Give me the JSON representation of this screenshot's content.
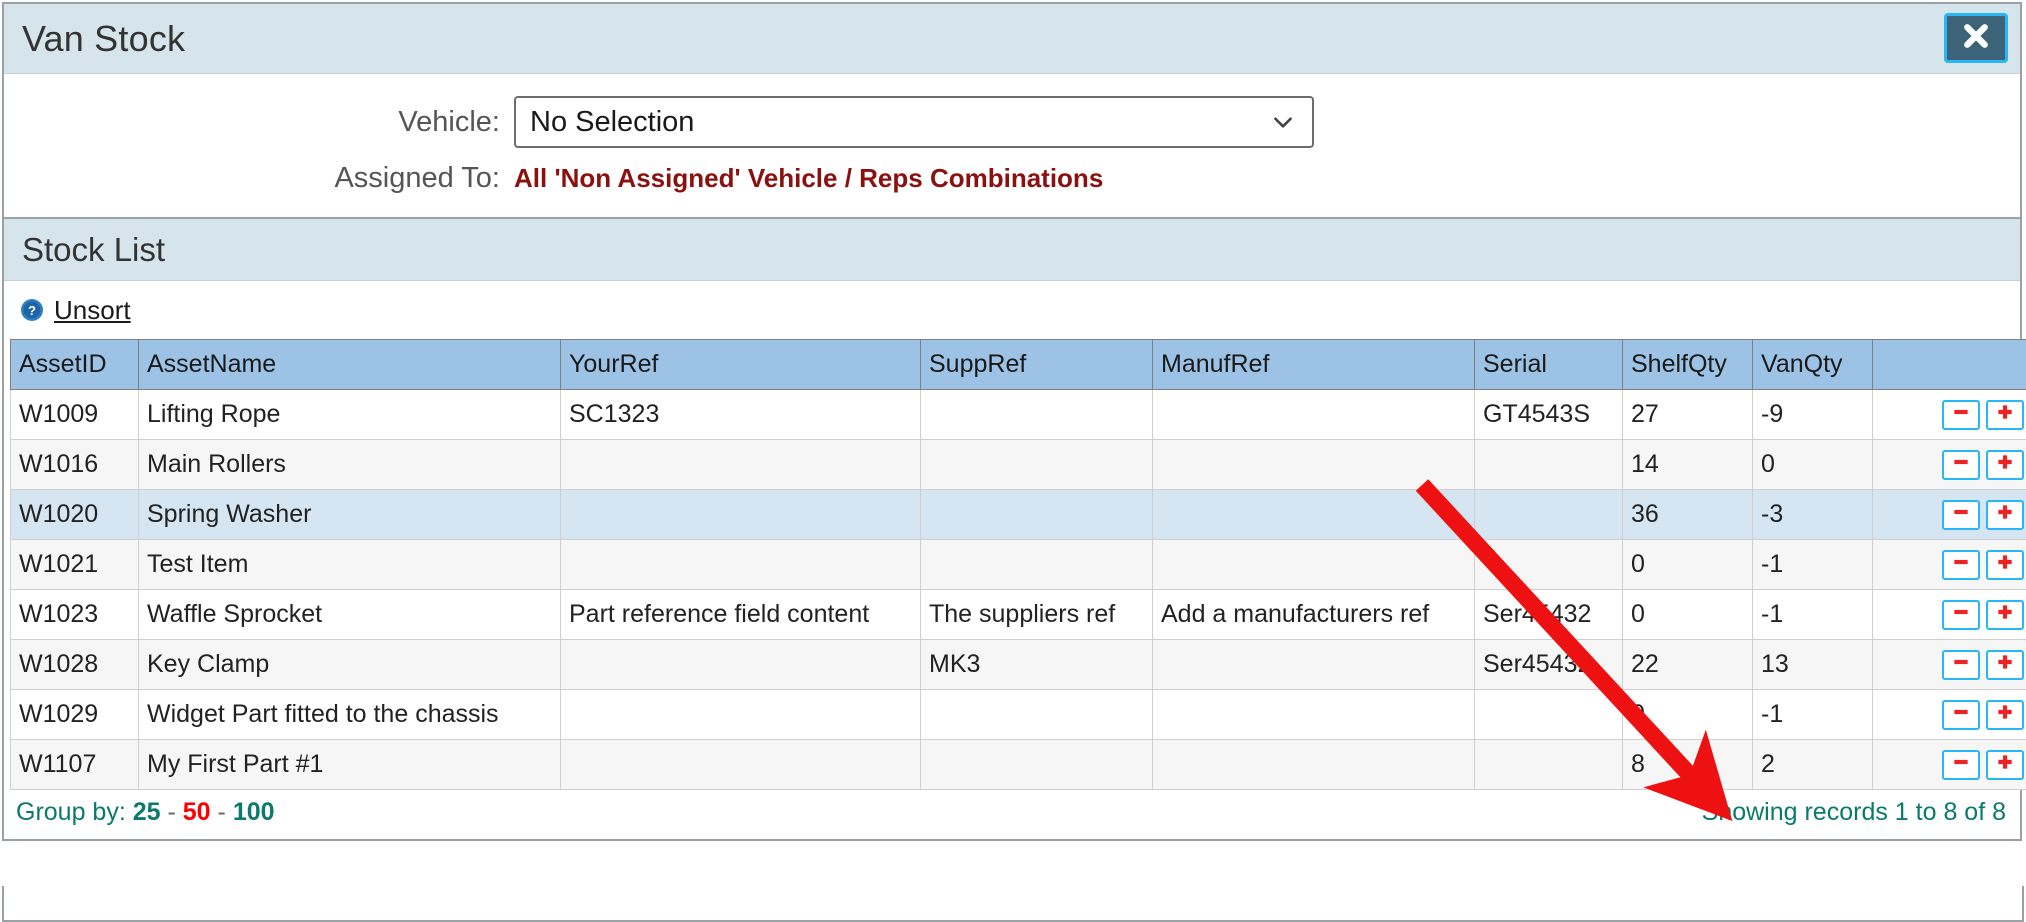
{
  "window": {
    "title": "Van Stock",
    "close_icon": "close-x-icon"
  },
  "form": {
    "vehicle_label": "Vehicle:",
    "vehicle_value": "No Selection",
    "vehicle_chevron_icon": "chevron-down-icon",
    "assigned_label": "Assigned To:",
    "assigned_value": "All 'Non Assigned' Vehicle / Reps Combinations"
  },
  "stock_panel": {
    "title": "Stock List",
    "help_icon": "help-question-icon",
    "unsort_label": "Unsort"
  },
  "table": {
    "columns": [
      "AssetID",
      "AssetName",
      "YourRef",
      "SuppRef",
      "ManufRef",
      "Serial",
      "ShelfQty",
      "VanQty",
      ""
    ],
    "rows": [
      {
        "asset_id": "W1009",
        "asset_name": "Lifting Rope",
        "your_ref": "SC1323",
        "supp_ref": "",
        "manuf_ref": "",
        "serial": "GT4543S",
        "shelf_qty": "27",
        "van_qty": "-9"
      },
      {
        "asset_id": "W1016",
        "asset_name": "Main Rollers",
        "your_ref": "",
        "supp_ref": "",
        "manuf_ref": "",
        "serial": "",
        "shelf_qty": "14",
        "van_qty": "0"
      },
      {
        "asset_id": "W1020",
        "asset_name": "Spring Washer",
        "your_ref": "",
        "supp_ref": "",
        "manuf_ref": "",
        "serial": "",
        "shelf_qty": "36",
        "van_qty": "-3"
      },
      {
        "asset_id": "W1021",
        "asset_name": "Test Item",
        "your_ref": "",
        "supp_ref": "",
        "manuf_ref": "",
        "serial": "",
        "shelf_qty": "0",
        "van_qty": "-1"
      },
      {
        "asset_id": "W1023",
        "asset_name": "Waffle Sprocket",
        "your_ref": "Part reference field content",
        "supp_ref": "The suppliers ref",
        "manuf_ref": "Add a manufacturers ref",
        "serial": "Ser45432",
        "shelf_qty": "0",
        "van_qty": "-1"
      },
      {
        "asset_id": "W1028",
        "asset_name": "Key Clamp",
        "your_ref": "",
        "supp_ref": "MK3",
        "manuf_ref": "",
        "serial": "Ser45432",
        "shelf_qty": "22",
        "van_qty": "13"
      },
      {
        "asset_id": "W1029",
        "asset_name": "Widget Part fitted to the chassis",
        "your_ref": "",
        "supp_ref": "",
        "manuf_ref": "",
        "serial": "",
        "shelf_qty": "0",
        "van_qty": "-1"
      },
      {
        "asset_id": "W1107",
        "asset_name": "My First Part #1",
        "your_ref": "",
        "supp_ref": "",
        "manuf_ref": "",
        "serial": "",
        "shelf_qty": "8",
        "van_qty": "2"
      }
    ],
    "row_actions": {
      "decrement_icon": "minus-icon",
      "increment_icon": "plus-icon"
    }
  },
  "footer": {
    "group_by_label": "Group by:",
    "group_by_options": [
      "25",
      "50",
      "100"
    ],
    "group_by_selected": "50",
    "separator": "-",
    "showing_records": "Showing records 1 to 8 of 8"
  },
  "annotation": {
    "type": "arrow",
    "color": "#ee1111",
    "points_at": "VanQty column"
  },
  "colors": {
    "titlebar_bg": "#d6e4ec",
    "header_row_bg": "#9cc3e5",
    "highlight_row_bg": "#d6e5f2",
    "accent_teal": "#0b7a6b",
    "accent_red": "#ff0000",
    "assigned_text": "#8b1010",
    "button_border": "#29b6f6"
  }
}
